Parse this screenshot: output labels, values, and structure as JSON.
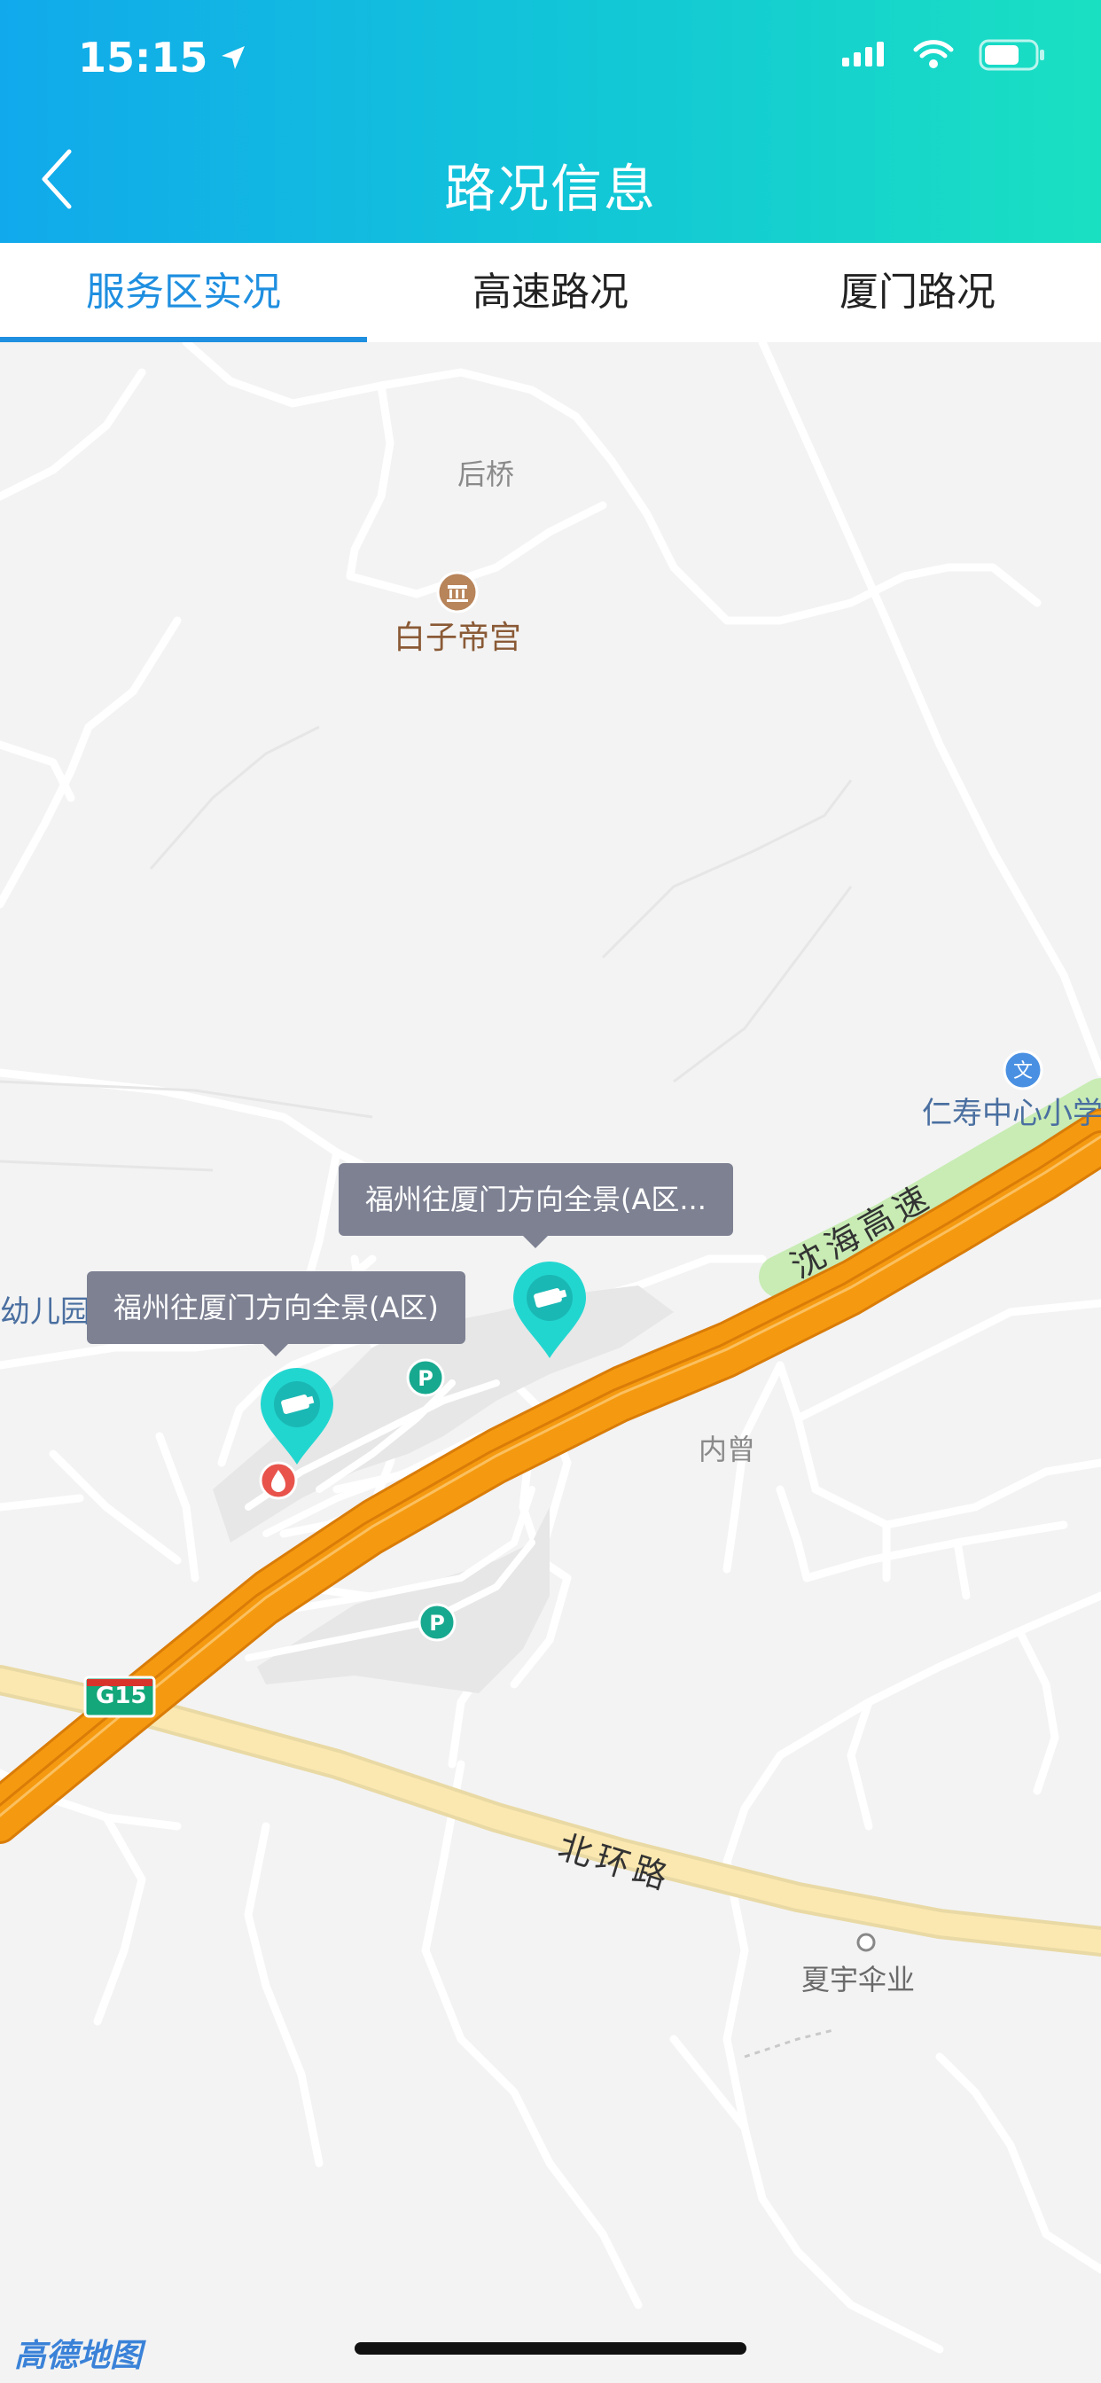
{
  "status": {
    "time": "15:15"
  },
  "header": {
    "title": "路况信息"
  },
  "tabs": [
    {
      "label": "服务区实况",
      "active": true
    },
    {
      "label": "高速路况",
      "active": false
    },
    {
      "label": "厦门路况",
      "active": false
    }
  ],
  "map": {
    "labels": {
      "houqiao": "后桥",
      "baizidigong": "白子帝宫",
      "renshou": "仁寿中心小学",
      "youeryuan": "幼儿园",
      "neizeng": "内曾",
      "xiayu": "夏宇伞业",
      "shenhai": "沈海高速",
      "beihuan": "北环路",
      "g15": "G15"
    },
    "callouts": {
      "a": "福州往厦门方向全景(A区)",
      "b": "福州往厦门方向全景(A区..."
    },
    "logo": "高德地图"
  },
  "colors": {
    "accent": "#1f8fe0",
    "highway": "#f59a10",
    "arterial": "#f8e2a0",
    "pin": "#22d6d0",
    "parking": "#17a98f",
    "gas": "#e8544c"
  }
}
